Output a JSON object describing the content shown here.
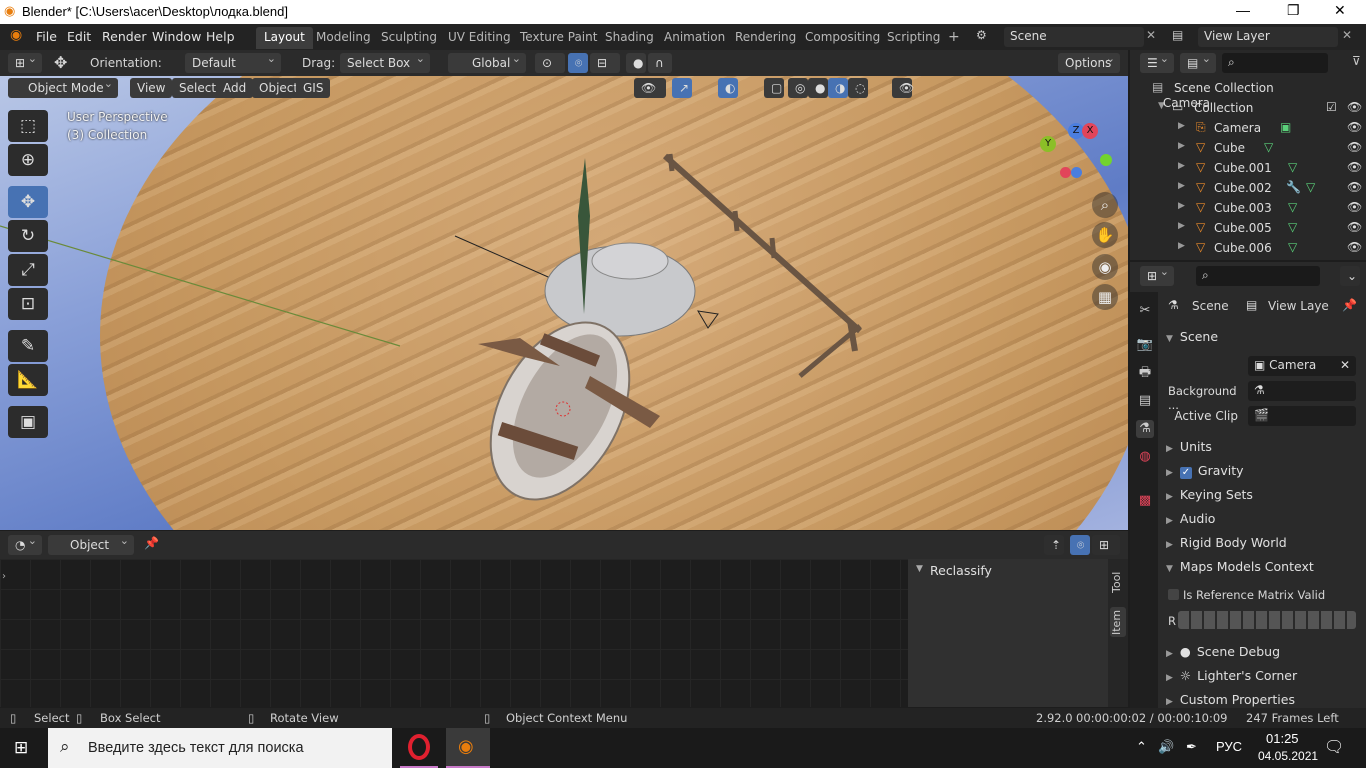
{
  "window": {
    "title": "Blender* [C:\\Users\\acer\\Desktop\\лодка.blend]",
    "minimize": "—",
    "maximize": "❐",
    "close": "✕"
  },
  "menubar": {
    "items": [
      "File",
      "Edit",
      "Render",
      "Window",
      "Help"
    ]
  },
  "workspaces": {
    "tabs": [
      "Layout",
      "Modeling",
      "Sculpting",
      "UV Editing",
      "Texture Paint",
      "Shading",
      "Animation",
      "Rendering",
      "Compositing",
      "Scripting"
    ],
    "active": "Layout",
    "add": "+"
  },
  "scene_selector": {
    "value": "Scene"
  },
  "view_layer_selector": {
    "value": "View Layer"
  },
  "tool_header": {
    "orientation_label": "Orientation:",
    "orientation_value": "Default",
    "drag_label": "Drag:",
    "drag_value": "Select Box",
    "transform_value": "Global",
    "options": "Options"
  },
  "viewport_header": {
    "mode": "Object Mode",
    "menus": [
      "View",
      "Select",
      "Add",
      "Object",
      "GIS"
    ]
  },
  "viewport": {
    "perspective": "User Perspective",
    "collection": "(3) Collection",
    "gizmo": {
      "x": "X",
      "y": "Y",
      "z": "Z"
    }
  },
  "toolbar": {
    "icons": [
      "select-box-icon",
      "cursor-icon",
      "move-icon",
      "rotate-icon",
      "scale-icon",
      "transform-icon",
      "annotate-icon",
      "measure-icon",
      "add-cube-icon"
    ],
    "active_index": 2
  },
  "outliner": {
    "root": "Scene Collection",
    "collection": "Collection",
    "items": [
      {
        "name": "Camera",
        "extra": "camera-data-icon"
      },
      {
        "name": "Cube",
        "extra": "mesh-data-icon"
      },
      {
        "name": "Cube.001",
        "extra": "mesh-data-icon"
      },
      {
        "name": "Cube.002",
        "extra": "modifier-icon"
      },
      {
        "name": "Cube.003",
        "extra": "mesh-data-icon"
      },
      {
        "name": "Cube.005",
        "extra": "mesh-data-icon"
      },
      {
        "name": "Cube.006",
        "extra": "mesh-data-icon"
      }
    ]
  },
  "properties": {
    "breadcrumb_scene": "Scene",
    "breadcrumb_view_layer": "View Laye",
    "scene_panel": "Scene",
    "camera_label": "Camera",
    "camera_value": "Camera",
    "background_label": "Background ...",
    "active_clip_label": "Active Clip",
    "sections": [
      "Units",
      "Gravity",
      "Keying Sets",
      "Audio",
      "Rigid Body World",
      "Maps Models Context"
    ],
    "gravity_checked": true,
    "is_ref_label": "Is Reference Matrix Valid",
    "r_label": "R",
    "scene_debug": "Scene Debug",
    "lighters_corner": "Lighter's Corner",
    "custom_properties": "Custom Properties"
  },
  "bottom_editor": {
    "object_selector": "Object",
    "panel_title": "Reclassify",
    "side_tabs": [
      "Tool",
      "Item"
    ]
  },
  "statusbar": {
    "select": "Select",
    "box_select": "Box Select",
    "rotate_view": "Rotate View",
    "context_menu": "Object Context Menu",
    "version": "2.92.0",
    "time": "00:00:00:02 / 00:00:10:09",
    "frames_left": "247 Frames Left"
  },
  "taskbar": {
    "search_placeholder": "Введите здесь текст для поиска",
    "language": "РУС",
    "time": "01:25",
    "date": "04.05.2021"
  },
  "colors": {
    "accent": "#4772b3",
    "outliner_orange": "#e98a2b",
    "mesh_green": "#5bd07a",
    "sand": "#c69860"
  }
}
